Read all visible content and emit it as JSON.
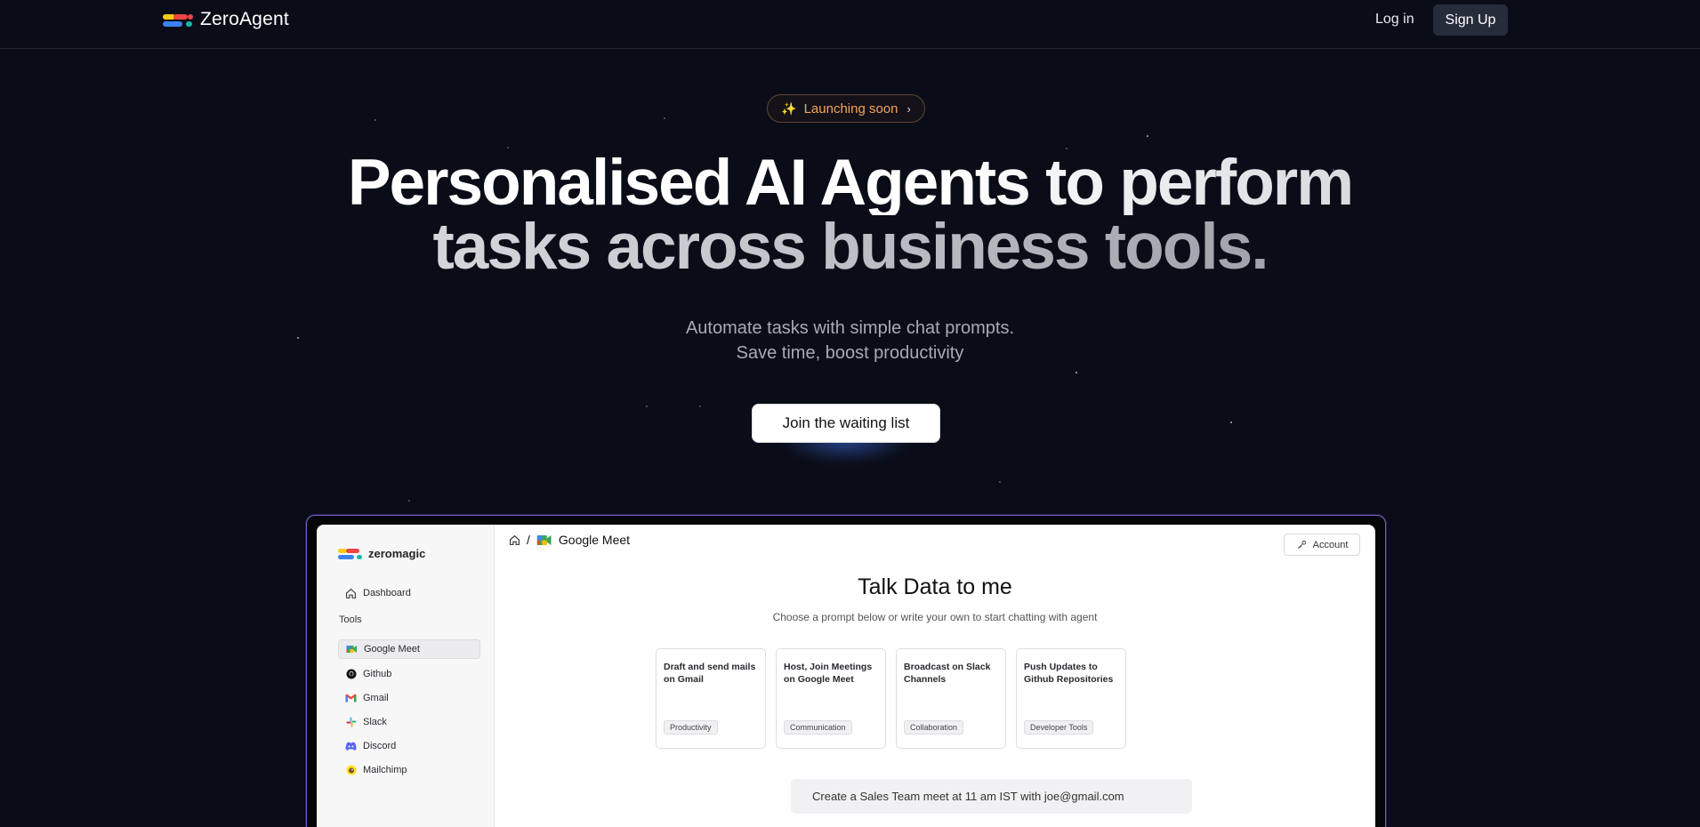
{
  "nav": {
    "brand": "ZeroAgent",
    "login": "Log in",
    "signup": "Sign Up"
  },
  "hero": {
    "badge": "Launching soon",
    "headline_line1": "Personalised AI Agents to perform",
    "headline_line2": "tasks across business tools.",
    "subtitle_line1": "Automate tasks with simple chat prompts.",
    "subtitle_line2": "Save time, boost productivity",
    "cta": "Join the waiting list"
  },
  "app": {
    "brand": "zeromagic",
    "sidebar": {
      "dashboard": "Dashboard",
      "tools_heading": "Tools",
      "tools": [
        {
          "label": "Google Meet",
          "icon": "google-meet-icon",
          "active": true
        },
        {
          "label": "Github",
          "icon": "github-icon",
          "active": false
        },
        {
          "label": "Gmail",
          "icon": "gmail-icon",
          "active": false
        },
        {
          "label": "Slack",
          "icon": "slack-icon",
          "active": false
        },
        {
          "label": "Discord",
          "icon": "discord-icon",
          "active": false
        },
        {
          "label": "Mailchimp",
          "icon": "mailchimp-icon",
          "active": false
        }
      ]
    },
    "breadcrumb": {
      "separator": "/",
      "current": "Google Meet"
    },
    "account": "Account",
    "title": "Talk Data to me",
    "subtitle": "Choose a prompt below or write your own to start chatting with agent",
    "cards": [
      {
        "title": "Draft and send mails on Gmail",
        "tag": "Productivity"
      },
      {
        "title": "Host, Join Meetings on Google Meet",
        "tag": "Communication"
      },
      {
        "title": "Broadcast on Slack Channels",
        "tag": "Collaboration"
      },
      {
        "title": "Push Updates to Github Repositories",
        "tag": "Developer Tools"
      }
    ],
    "prompt": "Create a Sales Team meet at 11 am IST with joe@gmail.com"
  },
  "colors": {
    "background": "#0a0d17",
    "badge_text": "#f2a55a",
    "frame_border": "#7b5fc9",
    "logo_red": "#ef4444",
    "logo_blue": "#3b82f6",
    "logo_yellow": "#facc15",
    "logo_teal": "#14b8a6"
  }
}
